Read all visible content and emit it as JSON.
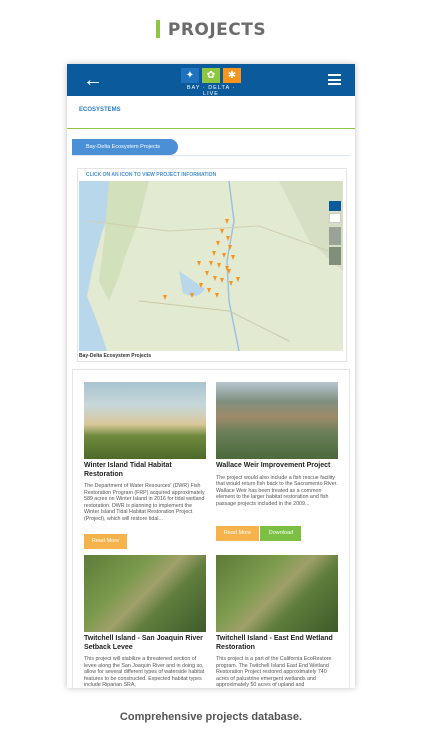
{
  "banner": {
    "title": "PROJECTS"
  },
  "app": {
    "brand": "BAY · DELTA · LIVE",
    "back_icon": "arrow-left-icon",
    "menu_icon": "hamburger-menu-icon"
  },
  "breadcrumb": "ECOSYSTEMS",
  "tab": {
    "label": "Bay-Delta Ecosystem Projects"
  },
  "map": {
    "instruction": "CLICK ON AN ICON TO VIEW PROJECT INFORMATION",
    "caption": "Bay-Delta Ecosystem Projects",
    "marker_color": "#f7941d"
  },
  "projects": [
    {
      "title": "Winter Island Tidal Habitat Restoration",
      "description": "The Department of Water Resources' (DWR) Fish Restoration Program (FRP) acquired approximately 589 acres on Winter Island in 2016 for tidal wetland restoration. DWR is planning to implement the Winter Island Tidal Habitat Restoration Project (Project), which will restore tidal...",
      "read_more": "Read More"
    },
    {
      "title": "Wallace Weir Improvement Project",
      "description": "The project would also include a fish rescue facility that would return fish back to the Sacramento River. Wallace Weir has been treated as a common element to the larger habitat restoration and fish passage projects included in the 2009...",
      "read_more": "Read More",
      "download": "Download"
    },
    {
      "title": "Twitchell Island - San Joaquin River Setback Levee",
      "description": "This project will stabilize a threatened section of levee along the San Joaquin River and in doing so, allow for several different types of waterside habitat features to be constructed. Expected habitat types include Riparian SRA,"
    },
    {
      "title": "Twitchell Island - East End Wetland Restoration",
      "description": "This project is a part of the California EcoRestore program. The Twitchell Island East End Wetland Restoration Project restored approximately 740 acres of palustrine emergent wetlands and approximately 50 acres of upland and"
    }
  ],
  "footer": {
    "caption": "Comprehensive projects database."
  }
}
